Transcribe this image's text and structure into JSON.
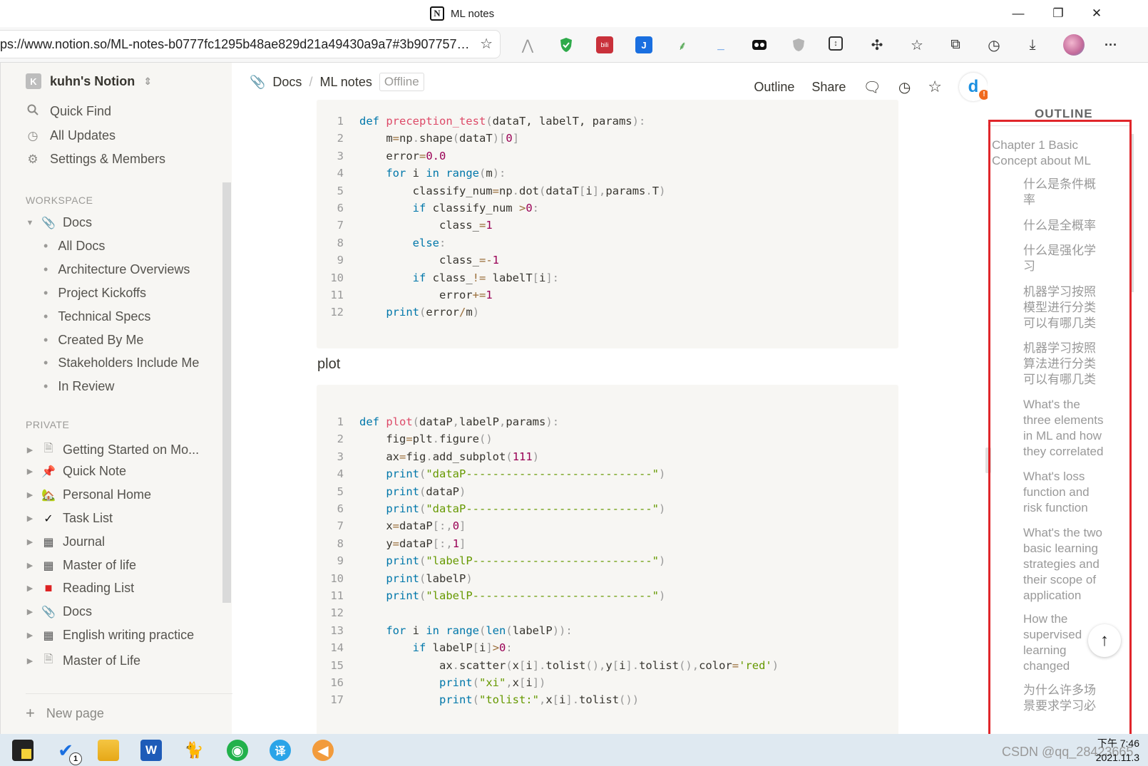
{
  "window": {
    "title": "ML notes",
    "logo_letter": "N",
    "controls": {
      "minimize": "—",
      "maximize": "❐",
      "close": "✕"
    }
  },
  "browser": {
    "url": "ps://www.notion.so/ML-notes-b0777fc1295b48ae829d21a49430a9a7#3b9077576...",
    "favorite_add_icon": "☆",
    "toolbar_icons": [
      "pdf-icon",
      "adblock-shield-icon",
      "bilibili-icon",
      "extension-j-icon",
      "extension-leaf-icon",
      "extension-underscore-icon",
      "extension-mask-icon",
      "extension-shield-icon",
      "extension-save-icon",
      "extensions-puzzle-icon",
      "favorites-icon",
      "collections-icon",
      "history-icon",
      "downloads-icon",
      "profile-avatar",
      "more-icon"
    ],
    "more_label": "···"
  },
  "sidebar": {
    "workspace_name": "kuhn's Notion",
    "workspace_letter": "K",
    "top_items": [
      {
        "label": "Quick Find",
        "icon": "search-icon"
      },
      {
        "label": "All Updates",
        "icon": "clock-icon"
      },
      {
        "label": "Settings & Members",
        "icon": "gear-icon"
      }
    ],
    "workspace_heading": "WORKSPACE",
    "docs_label": "Docs",
    "docs_children": [
      "All Docs",
      "Architecture Overviews",
      "Project Kickoffs",
      "Technical Specs",
      "Created By Me",
      "Stakeholders Include Me",
      "In Review"
    ],
    "private_heading": "PRIVATE",
    "private_pages": [
      {
        "label": "Getting Started on Mo...",
        "icon": "page-icon"
      },
      {
        "label": "Quick Note",
        "icon": "pushpin-icon"
      },
      {
        "label": "Personal Home",
        "icon": "house-icon"
      },
      {
        "label": "Task List",
        "icon": "checkmark-icon"
      },
      {
        "label": "Journal",
        "icon": "notebook-icon"
      },
      {
        "label": "Master of life",
        "icon": "notebook-icon"
      },
      {
        "label": "Reading List",
        "icon": "red-book-icon"
      },
      {
        "label": "Docs",
        "icon": "paperclip-icon"
      },
      {
        "label": "English writing practice",
        "icon": "notebook-icon"
      },
      {
        "label": "Master of Life",
        "icon": "page-icon"
      }
    ],
    "new_page_label": "New page"
  },
  "header": {
    "breadcrumb": [
      "Docs",
      "ML notes"
    ],
    "breadcrumb_sep": "/",
    "offline_badge": "Offline",
    "outline_label": "Outline",
    "share_label": "Share"
  },
  "code_block_1": [
    [
      [
        "kw",
        "def "
      ],
      [
        "fn",
        "preception_test"
      ],
      [
        "pu",
        "("
      ],
      [
        "",
        "dataT, labelT, params"
      ],
      [
        "pu",
        "):"
      ]
    ],
    [
      [
        "",
        "    m"
      ],
      [
        "op",
        "="
      ],
      [
        "",
        "np"
      ],
      [
        "pu",
        "."
      ],
      [
        "",
        "shape"
      ],
      [
        "pu",
        "("
      ],
      [
        "",
        "dataT"
      ],
      [
        "pu",
        ")["
      ],
      [
        "num",
        "0"
      ],
      [
        "pu",
        "]"
      ]
    ],
    [
      [
        "",
        "    error"
      ],
      [
        "op",
        "="
      ],
      [
        "num",
        "0.0"
      ]
    ],
    [
      [
        "kw",
        "    for "
      ],
      [
        "",
        "i "
      ],
      [
        "kw",
        "in "
      ],
      [
        "kw",
        "range"
      ],
      [
        "pu",
        "("
      ],
      [
        "",
        "m"
      ],
      [
        "pu",
        "):"
      ]
    ],
    [
      [
        "",
        "        classify_num"
      ],
      [
        "op",
        "="
      ],
      [
        "",
        "np"
      ],
      [
        "pu",
        "."
      ],
      [
        "",
        "dot"
      ],
      [
        "pu",
        "("
      ],
      [
        "",
        "dataT"
      ],
      [
        "pu",
        "["
      ],
      [
        "",
        "i"
      ],
      [
        "pu",
        "],"
      ],
      [
        "",
        "params"
      ],
      [
        "pu",
        "."
      ],
      [
        "",
        "T"
      ],
      [
        "pu",
        ")"
      ]
    ],
    [
      [
        "kw",
        "        if "
      ],
      [
        "",
        "classify_num "
      ],
      [
        "op",
        ">"
      ],
      [
        "num",
        "0"
      ],
      [
        "pu",
        ":"
      ]
    ],
    [
      [
        "",
        "            class_"
      ],
      [
        "op",
        "="
      ],
      [
        "num",
        "1"
      ]
    ],
    [
      [
        "kw",
        "        else"
      ],
      [
        "pu",
        ":"
      ]
    ],
    [
      [
        "",
        "            class_"
      ],
      [
        "op",
        "=-"
      ],
      [
        "num",
        "1"
      ]
    ],
    [
      [
        "kw",
        "        if "
      ],
      [
        "",
        "class_"
      ],
      [
        "op",
        "!= "
      ],
      [
        "",
        "labelT"
      ],
      [
        "pu",
        "["
      ],
      [
        "",
        "i"
      ],
      [
        "pu",
        "]:"
      ]
    ],
    [
      [
        "",
        "            error"
      ],
      [
        "op",
        "+="
      ],
      [
        "num",
        "1"
      ]
    ],
    [
      [
        "kw",
        "    print"
      ],
      [
        "pu",
        "("
      ],
      [
        "",
        "error"
      ],
      [
        "op",
        "/"
      ],
      [
        "",
        "m"
      ],
      [
        "pu",
        ")"
      ]
    ]
  ],
  "plot_heading": "plot",
  "code_block_2": [
    [
      [
        "kw",
        "def "
      ],
      [
        "fn",
        "plot"
      ],
      [
        "pu",
        "("
      ],
      [
        "",
        "dataP"
      ],
      [
        "pu",
        ","
      ],
      [
        "",
        "labelP"
      ],
      [
        "pu",
        ","
      ],
      [
        "",
        "params"
      ],
      [
        "pu",
        "):"
      ]
    ],
    [
      [
        "",
        "    fig"
      ],
      [
        "op",
        "="
      ],
      [
        "",
        "plt"
      ],
      [
        "pu",
        "."
      ],
      [
        "",
        "figure"
      ],
      [
        "pu",
        "()"
      ]
    ],
    [
      [
        "",
        "    ax"
      ],
      [
        "op",
        "="
      ],
      [
        "",
        "fig"
      ],
      [
        "pu",
        "."
      ],
      [
        "",
        "add_subplot"
      ],
      [
        "pu",
        "("
      ],
      [
        "num",
        "111"
      ],
      [
        "pu",
        ")"
      ]
    ],
    [
      [
        "kw",
        "    print"
      ],
      [
        "pu",
        "("
      ],
      [
        "str",
        "\"dataP----------------------------\""
      ],
      [
        "pu",
        ")"
      ]
    ],
    [
      [
        "kw",
        "    print"
      ],
      [
        "pu",
        "("
      ],
      [
        "",
        "dataP"
      ],
      [
        "pu",
        ")"
      ]
    ],
    [
      [
        "kw",
        "    print"
      ],
      [
        "pu",
        "("
      ],
      [
        "str",
        "\"dataP----------------------------\""
      ],
      [
        "pu",
        ")"
      ]
    ],
    [
      [
        "",
        "    x"
      ],
      [
        "op",
        "="
      ],
      [
        "",
        "dataP"
      ],
      [
        "pu",
        "[:,"
      ],
      [
        "num",
        "0"
      ],
      [
        "pu",
        "]"
      ]
    ],
    [
      [
        "",
        "    y"
      ],
      [
        "op",
        "="
      ],
      [
        "",
        "dataP"
      ],
      [
        "pu",
        "[:,"
      ],
      [
        "num",
        "1"
      ],
      [
        "pu",
        "]"
      ]
    ],
    [
      [
        "kw",
        "    print"
      ],
      [
        "pu",
        "("
      ],
      [
        "str",
        "\"labelP---------------------------\""
      ],
      [
        "pu",
        ")"
      ]
    ],
    [
      [
        "kw",
        "    print"
      ],
      [
        "pu",
        "("
      ],
      [
        "",
        "labelP"
      ],
      [
        "pu",
        ")"
      ]
    ],
    [
      [
        "kw",
        "    print"
      ],
      [
        "pu",
        "("
      ],
      [
        "str",
        "\"labelP---------------------------\""
      ],
      [
        "pu",
        ")"
      ]
    ],
    [],
    [
      [
        "kw",
        "    for "
      ],
      [
        "",
        "i "
      ],
      [
        "kw",
        "in "
      ],
      [
        "kw",
        "range"
      ],
      [
        "pu",
        "("
      ],
      [
        "kw",
        "len"
      ],
      [
        "pu",
        "("
      ],
      [
        "",
        "labelP"
      ],
      [
        "pu",
        ")):"
      ]
    ],
    [
      [
        "kw",
        "        if "
      ],
      [
        "",
        "labelP"
      ],
      [
        "pu",
        "["
      ],
      [
        "",
        "i"
      ],
      [
        "pu",
        "]"
      ],
      [
        "op",
        ">"
      ],
      [
        "num",
        "0"
      ],
      [
        "pu",
        ":"
      ]
    ],
    [
      [
        "",
        "            ax"
      ],
      [
        "pu",
        "."
      ],
      [
        "",
        "scatter"
      ],
      [
        "pu",
        "("
      ],
      [
        "",
        "x"
      ],
      [
        "pu",
        "["
      ],
      [
        "",
        "i"
      ],
      [
        "pu",
        "]."
      ],
      [
        "",
        "tolist"
      ],
      [
        "pu",
        "(),"
      ],
      [
        "",
        "y"
      ],
      [
        "pu",
        "["
      ],
      [
        "",
        "i"
      ],
      [
        "pu",
        "]."
      ],
      [
        "",
        "tolist"
      ],
      [
        "pu",
        "(),"
      ],
      [
        "",
        "color"
      ],
      [
        "op",
        "="
      ],
      [
        "str",
        "'red'"
      ],
      [
        "pu",
        ")"
      ]
    ],
    [
      [
        "kw",
        "            print"
      ],
      [
        "pu",
        "("
      ],
      [
        "str",
        "\"xi\""
      ],
      [
        "pu",
        ","
      ],
      [
        "",
        "x"
      ],
      [
        "pu",
        "["
      ],
      [
        "",
        "i"
      ],
      [
        "pu",
        "])"
      ]
    ],
    [
      [
        "kw",
        "            print"
      ],
      [
        "pu",
        "("
      ],
      [
        "str",
        "\"tolist:\""
      ],
      [
        "pu",
        ","
      ],
      [
        "",
        "x"
      ],
      [
        "pu",
        "["
      ],
      [
        "",
        "i"
      ],
      [
        "pu",
        "]."
      ],
      [
        "",
        "tolist"
      ],
      [
        "pu",
        "())"
      ]
    ]
  ],
  "outline": {
    "title": "OUTLINE",
    "items": [
      {
        "lines": [
          "Chapter 1 Basic",
          "Concept about ML"
        ],
        "level": 1
      },
      {
        "lines": [
          "什么是条件概",
          "率"
        ],
        "level": 2
      },
      {
        "lines": [
          "什么是全概率"
        ],
        "level": 2
      },
      {
        "lines": [
          "什么是强化学",
          "习"
        ],
        "level": 2
      },
      {
        "lines": [
          "机器学习按照",
          "模型进行分类",
          "可以有哪几类"
        ],
        "level": 2
      },
      {
        "lines": [
          "机器学习按照",
          "算法进行分类",
          "可以有哪几类"
        ],
        "level": 2
      },
      {
        "lines": [
          "What's the",
          "three elements",
          "in ML and how",
          "they correlated"
        ],
        "level": 2
      },
      {
        "lines": [
          "What's loss",
          "function and",
          "risk function"
        ],
        "level": 2
      },
      {
        "lines": [
          "What's the two",
          "basic learning",
          "strategies and",
          "their scope of",
          "application"
        ],
        "level": 2
      },
      {
        "lines": [
          "How the",
          "supervised",
          "learning",
          "changed"
        ],
        "level": 2
      },
      {
        "lines": [
          "为什么许多场",
          "景要求学习必"
        ],
        "level": 2
      }
    ],
    "back_to_top": "↑"
  },
  "taskbar": {
    "apps": [
      "sticky-notes-icon",
      "todo-icon",
      "file-explorer-icon",
      "word-icon",
      "cat-app-icon",
      "wechat-icon",
      "translator-icon",
      "audio-app-icon"
    ],
    "todo_badge": "1",
    "word_letter": "W",
    "translator_char": "译",
    "time": "下午 7:46",
    "date": "2021.11.3",
    "watermark": "CSDN @qq_28423665"
  },
  "colors": {
    "highlight_box": "#e0262b",
    "sidebar_bg": "#f7f6f3",
    "code_bg": "#f7f6f3"
  }
}
